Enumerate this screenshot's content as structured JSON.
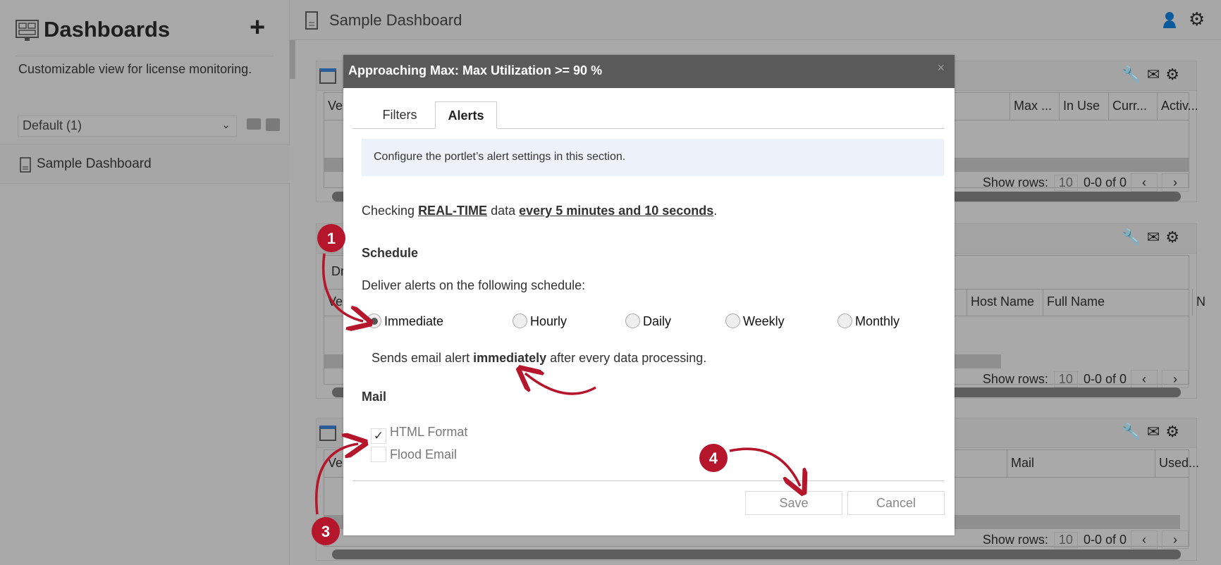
{
  "sidebar": {
    "title": "Dashboards",
    "add_icon": "plus-icon",
    "description": "Customizable view for license monitoring.",
    "view_select": "Default (1)",
    "items": [
      {
        "label": "Sample Dashboard"
      }
    ]
  },
  "header": {
    "title": "Sample Dashboard",
    "user_color": "#0a5a9c"
  },
  "portlets": [
    {
      "columns": [
        "Ver",
        "Max ...",
        "In Use",
        "Curr...",
        "Activ..."
      ],
      "show_rows_label": "Show rows:",
      "rows": "10",
      "range": "0-0 of 0"
    },
    {
      "filter_text": "Dr",
      "columns": [
        "Ver",
        "Host Name",
        "Full Name",
        "N"
      ],
      "show_rows_label": "Show rows:",
      "rows": "10",
      "range": "0-0 of 0"
    },
    {
      "columns": [
        "Ver",
        "Mail",
        "Used..."
      ],
      "show_rows_label": "Show rows:",
      "rows": "10",
      "range": "0-0 of 0"
    }
  ],
  "modal": {
    "title": "Approaching Max: Max Utilization >= 90 %",
    "close": "×",
    "tabs": [
      {
        "label": "Filters"
      },
      {
        "label": "Alerts",
        "active": true
      }
    ],
    "info": "Configure the portlet’s alert settings in this section.",
    "checking": {
      "prefix": "Checking",
      "mode": "REAL-TIME",
      "middle": "data",
      "interval": "every 5 minutes and 10 seconds",
      "suffix": "."
    },
    "schedule": {
      "heading": "Schedule",
      "intro": "Deliver alerts on the following schedule:",
      "options": [
        "Immediate",
        "Hourly",
        "Daily",
        "Weekly",
        "Monthly"
      ],
      "selected": "Immediate",
      "desc_prefix": "Sends email alert",
      "desc_bold": "immediately",
      "desc_suffix": "after every data processing."
    },
    "mail": {
      "heading": "Mail",
      "html_format": "HTML Format",
      "html_format_checked": true,
      "flood_email": "Flood Email",
      "flood_email_checked": false
    },
    "save": "Save",
    "cancel": "Cancel"
  },
  "annotations": {
    "color": "#b5162b",
    "markers": [
      "1",
      "3",
      "4"
    ]
  }
}
